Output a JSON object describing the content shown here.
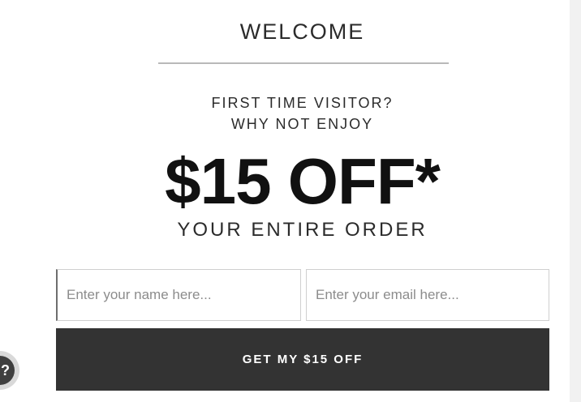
{
  "popup": {
    "title": "WELCOME",
    "line1": "FIRST TIME VISITOR?",
    "line2": "WHY NOT ENJOY",
    "headline": "$15 OFF*",
    "subline": "YOUR ENTIRE ORDER"
  },
  "form": {
    "name_placeholder": "Enter your name here...",
    "email_placeholder": "Enter your email here...",
    "submit_label": "GET MY $15 OFF"
  },
  "help_icon": "help-icon"
}
